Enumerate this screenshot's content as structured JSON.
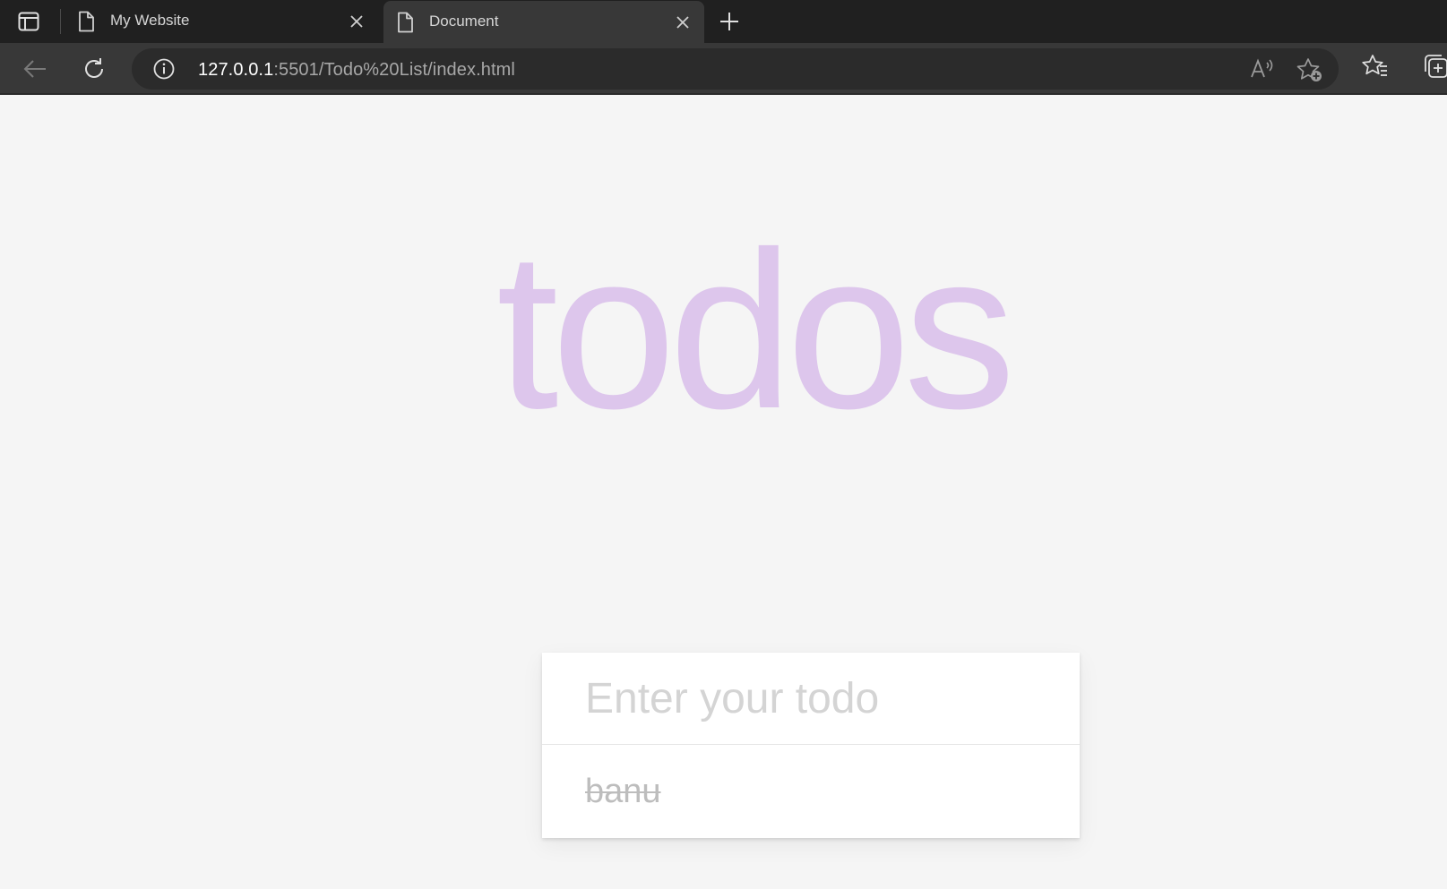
{
  "browser": {
    "tabs": [
      {
        "label": "My Website",
        "active": false
      },
      {
        "label": "Document",
        "active": true
      }
    ],
    "address": {
      "host": "127.0.0.1",
      "path": ":5501/Todo%20List/index.html"
    }
  },
  "app": {
    "title": "todos",
    "input_placeholder": "Enter your todo",
    "todos": [
      {
        "text": "banu",
        "completed": true
      }
    ]
  },
  "colors": {
    "title": "#ddc6ec",
    "background": "#f5f5f5",
    "completed_text": "#bdbdbd"
  }
}
